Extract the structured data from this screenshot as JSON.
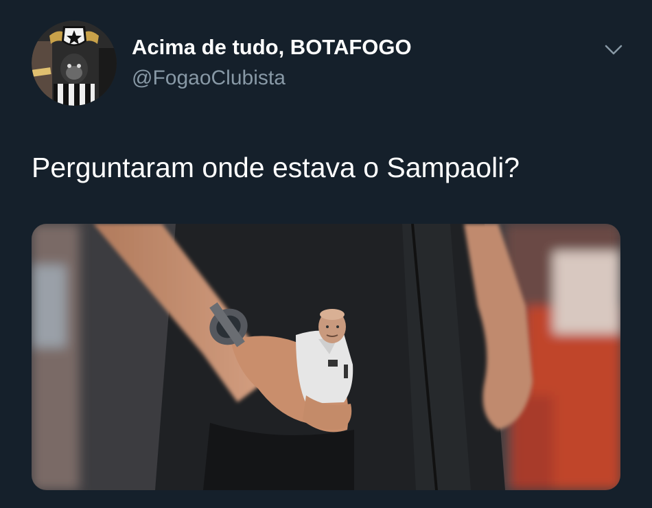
{
  "tweet": {
    "display_name": "Acima de tudo, BOTAFOGO",
    "handle": "@FogaoClubista",
    "text": "Perguntaram onde estava o Sampaoli?",
    "menu_icon": "chevron-down-icon",
    "avatar_icon": "avatar-botafogo-crest-icon"
  },
  "media": {
    "description_icon": "photo-icon"
  },
  "colors": {
    "background": "#15202b",
    "handle_gray": "#8899a6",
    "text_white": "#ffffff"
  }
}
